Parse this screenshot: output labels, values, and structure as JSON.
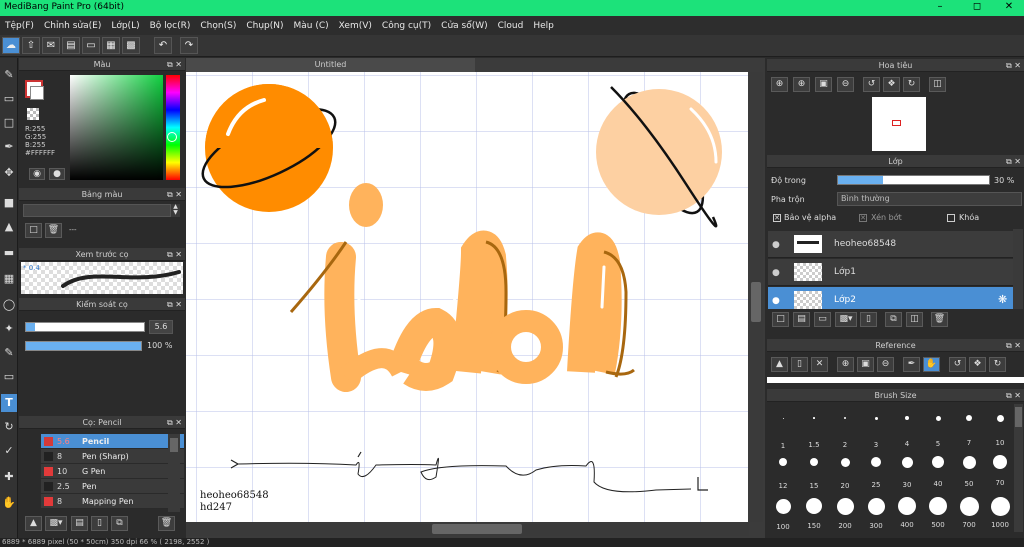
{
  "app": {
    "title": "MediBang Paint Pro (64bit)"
  },
  "menu": [
    "Tệp(F)",
    "Chỉnh sửa(E)",
    "Lớp(L)",
    "Bộ lọc(R)",
    "Chọn(S)",
    "Chụp(N)",
    "Màu (C)",
    "Xem(V)",
    "Công cụ(T)",
    "Cửa sổ(W)",
    "Cloud",
    "Help"
  ],
  "color_panel": {
    "title": "Màu",
    "r": "R:255",
    "g": "G:255",
    "b": "B:255",
    "hex": "#FFFFFF"
  },
  "palette_panel": {
    "title": "Bảng màu",
    "value": "---"
  },
  "brush_preview": {
    "title": "Xem trước cọ",
    "size": "* 0.4"
  },
  "brush_control": {
    "title": "Kiểm soát cọ",
    "size": "5.6",
    "opacity": "100 %",
    "opacity_fraction": 1.0
  },
  "brush_list": {
    "title": "Cọ: Pencil",
    "items": [
      {
        "size": "5.6",
        "name": "Pencil",
        "color": "#d43a3a",
        "selected": true
      },
      {
        "size": "8",
        "name": "Pen (Sharp)",
        "color": "#222222",
        "selected": false
      },
      {
        "size": "10",
        "name": "G Pen",
        "color": "#e23a3a",
        "selected": false
      },
      {
        "size": "2.5",
        "name": "Pen",
        "color": "#222222",
        "selected": false
      },
      {
        "size": "8",
        "name": "Mapping Pen",
        "color": "#e23a3a",
        "selected": false
      }
    ]
  },
  "document": {
    "tab": "Untitled",
    "text_line1": "heoheo68548",
    "text_line2": "hd247"
  },
  "navigator": {
    "title": "Hoa tiêu"
  },
  "layer_panel": {
    "title": "Lớp",
    "opacity_label": "Độ trong",
    "opacity_value": "30 %",
    "opacity_fraction": 0.3,
    "blend_label": "Pha trộn",
    "blend_value": "Bình thường",
    "protect_alpha": "Bảo vệ alpha",
    "clipping": "Xén bớt",
    "lock": "Khóa",
    "layers": [
      {
        "name": "heoheo68548",
        "selected": false
      },
      {
        "name": "Lớp1",
        "selected": false
      },
      {
        "name": "Lớp2",
        "selected": true
      }
    ]
  },
  "reference_panel": {
    "title": "Reference"
  },
  "brush_size_panel": {
    "title": "Brush Size",
    "sizes": [
      "1",
      "1.5",
      "2",
      "3",
      "4",
      "5",
      "7",
      "10",
      "12",
      "15",
      "20",
      "25",
      "30",
      "40",
      "50",
      "70",
      "100",
      "150",
      "200",
      "300",
      "400",
      "500",
      "700",
      "1000"
    ]
  },
  "status": {
    "text": "6889 * 6889 pixel   (50 * 50cm)   350 dpi   66 %   ( 2198, 2552 )"
  },
  "colors": {
    "accent": "#1ce27a",
    "selection": "#4a8fd4",
    "planet_orange": "#ff8c00",
    "planet_peach": "#fdd0a2",
    "letters": "#ffb35c"
  }
}
